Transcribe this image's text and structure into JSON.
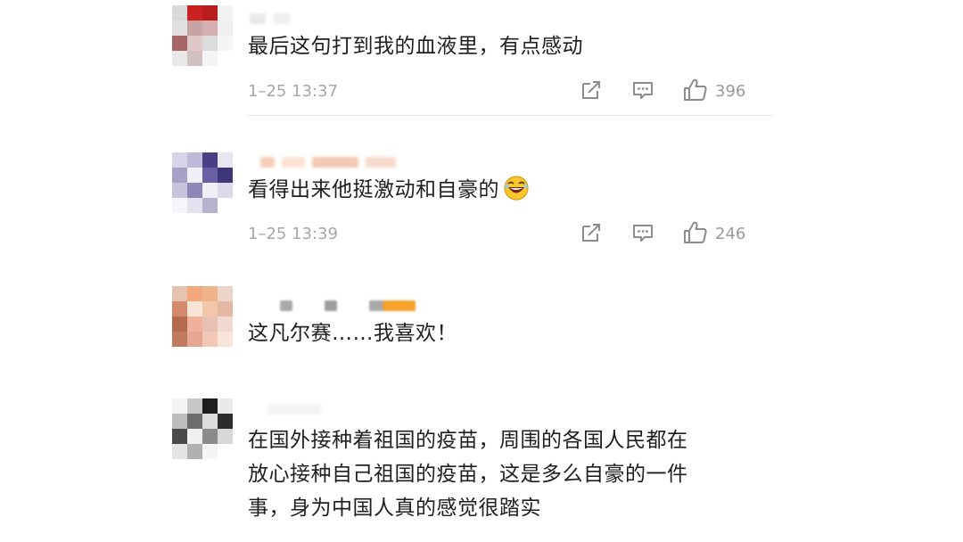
{
  "comments": [
    {
      "text": "最后这句打到我的血液里，有点感动",
      "time": "1–25 13:37",
      "likes": "396",
      "avatar_colors": [
        "#d9d9d9",
        "#c92020",
        "#b81c1c",
        "#f2f2f2",
        "#e0e0e0",
        "#c7a3a3",
        "#d4b0b0",
        "#efefef",
        "#a86565",
        "#e0c8c8",
        "#dcdcdc",
        "#f5f5f5",
        "#e8e8e8",
        "#d0c0c0",
        "#f4f4f4",
        "#ffffff"
      ]
    },
    {
      "text": "看得出来他挺激动和自豪的",
      "emoji": "laughing-emoji",
      "time": "1–25 13:39",
      "likes": "246",
      "avatar_colors": [
        "#d8d3e8",
        "#bfb8d6",
        "#4a3f86",
        "#e8e6f0",
        "#a7a0c4",
        "#f0eef6",
        "#6a5fa4",
        "#3e3678",
        "#c9c3dd",
        "#8e86b6",
        "#efeff5",
        "#ddd9ea",
        "#f6f5fa",
        "#e5e2ef",
        "#b7b0cf",
        "#ffffff"
      ]
    },
    {
      "text": "这凡尔赛……我喜欢！",
      "avatar_colors": [
        "#e6c3b0",
        "#f3a77b",
        "#f0b48c",
        "#ead5c8",
        "#d48a6a",
        "#f7e6d8",
        "#f2c6a8",
        "#e4b8a4",
        "#b56a4e",
        "#f0b09a",
        "#e7c1b3",
        "#f1d9cf",
        "#c27a5f",
        "#e5a792",
        "#f3c7b6",
        "#f9e4da"
      ]
    },
    {
      "text_lines": [
        "在国外接种着祖国的疫苗，周围的各国人民都在",
        "放心接种自己祖国的疫苗，这是多么自豪的一件",
        "事，身为中国人真的感觉很踏实"
      ],
      "avatar_colors": [
        "#f3f3f3",
        "#c8c8c8",
        "#1e1e1e",
        "#e9e9e9",
        "#bdbdbd",
        "#6d6d6d",
        "#dcdcdc",
        "#2b2b2b",
        "#4a4a4a",
        "#f0f0f0",
        "#8a8a8a",
        "#d7d7d7",
        "#e4e4e4",
        "#b0b0b0",
        "#f5f5f5",
        "#ffffff"
      ]
    }
  ]
}
